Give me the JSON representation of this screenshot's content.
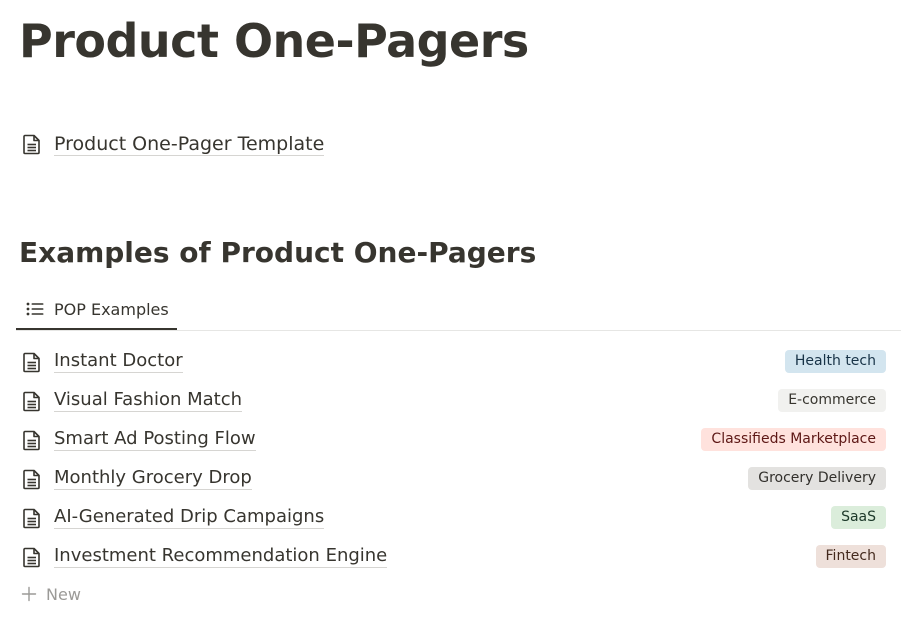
{
  "page": {
    "title": "Product One-Pagers"
  },
  "template_link": {
    "label": "Product One-Pager Template",
    "icon": "page-icon"
  },
  "section": {
    "heading": "Examples of Product One-Pagers"
  },
  "view_tab": {
    "label": "POP Examples",
    "icon": "list-icon"
  },
  "items": [
    {
      "title": "Instant Doctor",
      "tag": "Health tech",
      "tag_bg": "#d3e5ef",
      "tag_fg": "#183347"
    },
    {
      "title": "Visual Fashion Match",
      "tag": "E-commerce",
      "tag_bg": "#f1f1ef",
      "tag_fg": "#37352f"
    },
    {
      "title": "Smart Ad Posting Flow",
      "tag": "Classifieds Marketplace",
      "tag_bg": "#ffe2dd",
      "tag_fg": "#5d1715"
    },
    {
      "title": "Monthly Grocery Drop",
      "tag": "Grocery Delivery",
      "tag_bg": "#e3e2e0",
      "tag_fg": "#32302c"
    },
    {
      "title": "AI-Generated Drip Campaigns",
      "tag": "SaaS",
      "tag_bg": "#dbeddb",
      "tag_fg": "#1c3829"
    },
    {
      "title": "Investment Recommendation Engine",
      "tag": "Fintech",
      "tag_bg": "#eee0da",
      "tag_fg": "#442a1e"
    }
  ],
  "new_button": {
    "label": "New",
    "icon": "plus-icon"
  },
  "colors": {
    "text": "#37352f",
    "muted": "#9b9a97",
    "divider": "#e6e6e4"
  }
}
